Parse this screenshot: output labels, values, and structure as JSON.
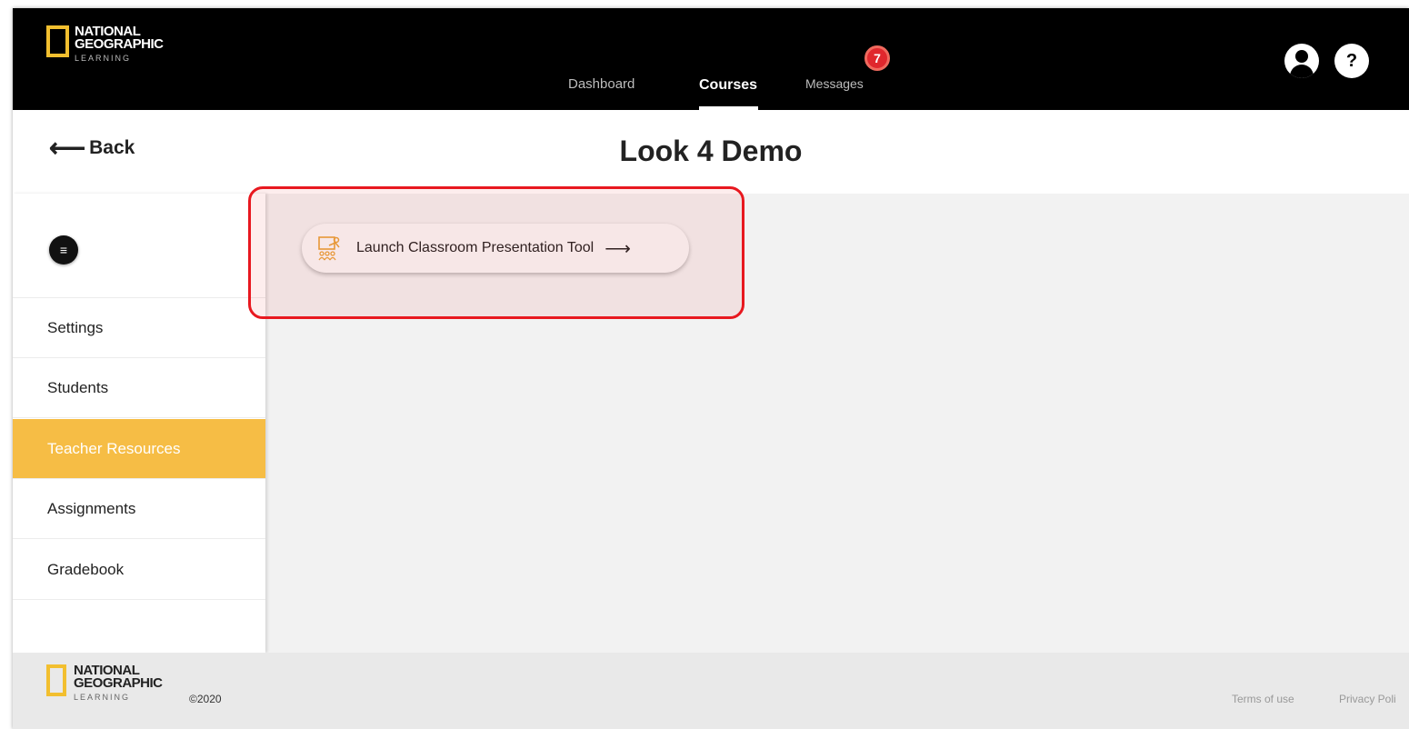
{
  "brand": {
    "logo_line1": "NATIONAL",
    "logo_line2": "GEOGRAPHIC",
    "logo_line3": "LEARNING",
    "accent_color": "#f2bf2f"
  },
  "topnav": {
    "items": [
      {
        "label": "Dashboard",
        "active": false
      },
      {
        "label": "Courses",
        "active": true
      },
      {
        "label": "Messages",
        "active": false
      }
    ],
    "messages_badge": "7",
    "help_label": "?",
    "icons": {
      "profile": "user-avatar-icon",
      "help": "help-icon"
    }
  },
  "header": {
    "back_arrow": "⟵",
    "back_label": "Back",
    "title": "Look 4 Demo"
  },
  "sidebar": {
    "toggle_glyph": "≡",
    "items": [
      {
        "label": "Settings",
        "active": false
      },
      {
        "label": "Students",
        "active": false
      },
      {
        "label": "Teacher Resources",
        "active": true
      },
      {
        "label": "Assignments",
        "active": false
      },
      {
        "label": "Gradebook",
        "active": false
      }
    ],
    "active_color": "#f6bd45"
  },
  "content": {
    "launch_label": "Launch Classroom Presentation Tool",
    "launch_arrow": "⟶",
    "launch_icon": "presentation-icon",
    "highlight_color": "#e8181f"
  },
  "footer": {
    "copyright": "©2020",
    "links": [
      "Terms of use",
      "Privacy Poli"
    ]
  }
}
